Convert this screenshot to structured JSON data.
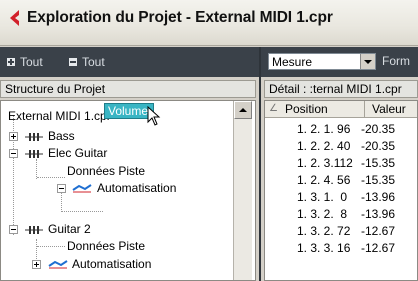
{
  "window": {
    "title": "Exploration du Projet - External MIDI 1.cpr"
  },
  "toolbar": {
    "expand_all_label": "Tout",
    "collapse_all_label": "Tout",
    "view_select_value": "Mesure",
    "format_label": "Form"
  },
  "left_panel": {
    "header": "Structure du Projet",
    "tree": [
      {
        "label": "External MIDI 1.cpr"
      },
      {
        "label": "Bass"
      },
      {
        "label": "Elec Guitar"
      },
      {
        "label": "Données Piste"
      },
      {
        "label": "Automatisation"
      },
      {
        "label": "Volume",
        "selected": true
      },
      {
        "label": "Guitar 2"
      },
      {
        "label": "Données Piste"
      },
      {
        "label": "Automatisation"
      }
    ]
  },
  "right_panel": {
    "header": "Détail :  :ternal MIDI 1.cpr",
    "columns": {
      "position": "Position",
      "value": "Valeur"
    },
    "rows": [
      {
        "position": "1. 2. 1. 96",
        "value": "-20.35"
      },
      {
        "position": "1. 2. 2. 40",
        "value": "-20.35"
      },
      {
        "position": "1. 2. 3.112",
        "value": "-15.35"
      },
      {
        "position": "1. 2. 4. 56",
        "value": "-15.35"
      },
      {
        "position": "1. 3. 1.  0",
        "value": "-13.96"
      },
      {
        "position": "1. 3. 2.  8",
        "value": "-13.96"
      },
      {
        "position": "1. 3. 2. 72",
        "value": "-12.67"
      },
      {
        "position": "1. 3. 3. 16",
        "value": "-12.67"
      }
    ]
  },
  "colors": {
    "toolbar_bg": "#3a4149",
    "selection": "#39b5c4",
    "cubase_red": "#d2202a"
  },
  "icons": [
    "cubase-logo-icon",
    "expand-all-icon",
    "collapse-all-icon",
    "midi-track-icon",
    "automation-icon",
    "mouse-pointer-icon"
  ]
}
